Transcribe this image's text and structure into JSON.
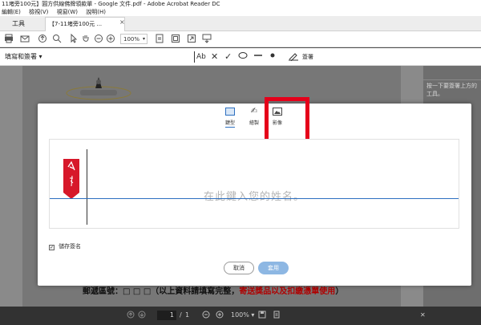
{
  "window": {
    "title": "11堵旁100元】圓方供線佛牌領款單 - Google 文件.pdf - Adobe Acrobat Reader DC"
  },
  "menubar": {
    "items": [
      "編輯(E)",
      "檢視(V)",
      "視窗(W)",
      "說明(H)"
    ]
  },
  "tabs": {
    "tools_label": "工具",
    "doc_label": "【7-11堵旁100元 ...",
    "close_glyph": "×"
  },
  "toolbar": {
    "zoom": "100%"
  },
  "fillbar": {
    "label": "填寫和簽署",
    "sign_label": "簽署"
  },
  "document": {
    "footer_text": "郵遞區號：□ □ □（以上資料請填寫完整，",
    "footer_red": "寄送獎品以及扣繳憑單使用",
    "footer_end": "）"
  },
  "right_panel": {
    "text": "按一下要簽署上方的工具。"
  },
  "bottombar": {
    "page_current": "1",
    "page_sep": "/",
    "page_total": "1",
    "zoom": "100%"
  },
  "dialog": {
    "modes": {
      "type": "鍵型",
      "draw": "繪製",
      "image": "影像"
    },
    "placeholder": "在此鍵入您的姓名。",
    "save_signature_label": "儲存簽名",
    "cancel_label": "取消",
    "apply_label": "套用"
  },
  "colors": {
    "highlight": "#e5001a",
    "accent": "#2d6fc0",
    "apply_disabled": "#8db7e3"
  }
}
